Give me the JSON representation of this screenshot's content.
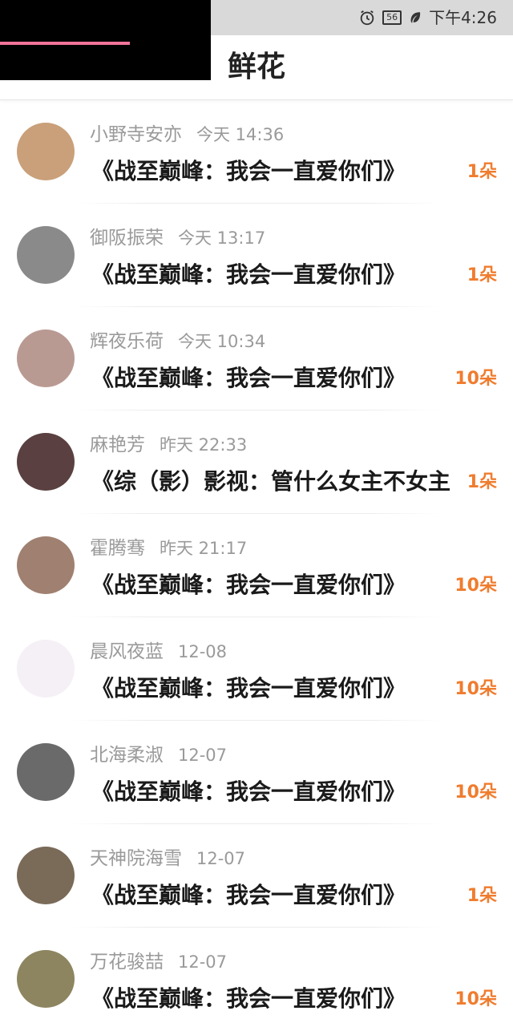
{
  "status_bar": {
    "time": "下午4:26",
    "signal": "56"
  },
  "header": {
    "title": "鲜花"
  },
  "flowers": [
    {
      "name": "小野寺安亦",
      "time": "今天 14:36",
      "book": "《战至巅峰：我会一直爱你们》",
      "count": "1朵",
      "avatar_color": "#c9a07a"
    },
    {
      "name": "御阪振荣",
      "time": "今天 13:17",
      "book": "《战至巅峰：我会一直爱你们》",
      "count": "1朵",
      "avatar_color": "#8a8a8a"
    },
    {
      "name": "辉夜乐荷",
      "time": "今天 10:34",
      "book": "《战至巅峰：我会一直爱你们》",
      "count": "10朵",
      "avatar_color": "#b99a93"
    },
    {
      "name": "麻艳芳",
      "time": "昨天 22:33",
      "book": "《综（影）影视：管什么女主不女主",
      "count": "1朵",
      "avatar_color": "#5a4040"
    },
    {
      "name": "霍腾骞",
      "time": "昨天 21:17",
      "book": "《战至巅峰：我会一直爱你们》",
      "count": "10朵",
      "avatar_color": "#a08070"
    },
    {
      "name": "晨风夜蓝",
      "time": "12-08",
      "book": "《战至巅峰：我会一直爱你们》",
      "count": "10朵",
      "avatar_color": "#f5f0f5"
    },
    {
      "name": "北海柔淑",
      "time": "12-07",
      "book": "《战至巅峰：我会一直爱你们》",
      "count": "10朵",
      "avatar_color": "#6a6a6a"
    },
    {
      "name": "天神院海雪",
      "time": "12-07",
      "book": "《战至巅峰：我会一直爱你们》",
      "count": "1朵",
      "avatar_color": "#7a6a58"
    },
    {
      "name": "万花骏喆",
      "time": "12-07",
      "book": "《战至巅峰：我会一直爱你们》",
      "count": "10朵",
      "avatar_color": "#8d8560"
    }
  ],
  "colors": {
    "accent": "#f07c2e",
    "progress": "#f2739a"
  }
}
